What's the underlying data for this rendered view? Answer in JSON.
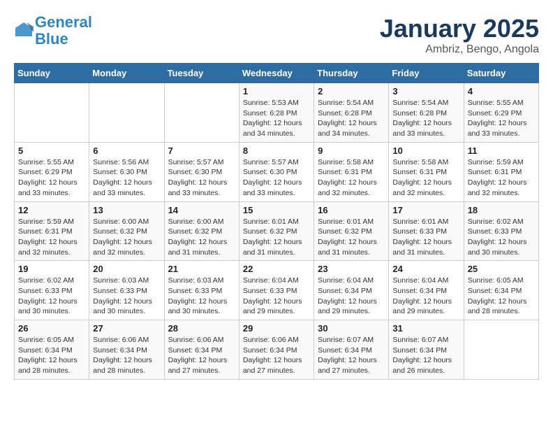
{
  "logo": {
    "line1": "General",
    "line2": "Blue"
  },
  "title": "January 2025",
  "subtitle": "Ambriz, Bengo, Angola",
  "weekdays": [
    "Sunday",
    "Monday",
    "Tuesday",
    "Wednesday",
    "Thursday",
    "Friday",
    "Saturday"
  ],
  "weeks": [
    [
      {
        "day": "",
        "info": ""
      },
      {
        "day": "",
        "info": ""
      },
      {
        "day": "",
        "info": ""
      },
      {
        "day": "1",
        "info": "Sunrise: 5:53 AM\nSunset: 6:28 PM\nDaylight: 12 hours\nand 34 minutes."
      },
      {
        "day": "2",
        "info": "Sunrise: 5:54 AM\nSunset: 6:28 PM\nDaylight: 12 hours\nand 34 minutes."
      },
      {
        "day": "3",
        "info": "Sunrise: 5:54 AM\nSunset: 6:28 PM\nDaylight: 12 hours\nand 33 minutes."
      },
      {
        "day": "4",
        "info": "Sunrise: 5:55 AM\nSunset: 6:29 PM\nDaylight: 12 hours\nand 33 minutes."
      }
    ],
    [
      {
        "day": "5",
        "info": "Sunrise: 5:55 AM\nSunset: 6:29 PM\nDaylight: 12 hours\nand 33 minutes."
      },
      {
        "day": "6",
        "info": "Sunrise: 5:56 AM\nSunset: 6:30 PM\nDaylight: 12 hours\nand 33 minutes."
      },
      {
        "day": "7",
        "info": "Sunrise: 5:57 AM\nSunset: 6:30 PM\nDaylight: 12 hours\nand 33 minutes."
      },
      {
        "day": "8",
        "info": "Sunrise: 5:57 AM\nSunset: 6:30 PM\nDaylight: 12 hours\nand 33 minutes."
      },
      {
        "day": "9",
        "info": "Sunrise: 5:58 AM\nSunset: 6:31 PM\nDaylight: 12 hours\nand 32 minutes."
      },
      {
        "day": "10",
        "info": "Sunrise: 5:58 AM\nSunset: 6:31 PM\nDaylight: 12 hours\nand 32 minutes."
      },
      {
        "day": "11",
        "info": "Sunrise: 5:59 AM\nSunset: 6:31 PM\nDaylight: 12 hours\nand 32 minutes."
      }
    ],
    [
      {
        "day": "12",
        "info": "Sunrise: 5:59 AM\nSunset: 6:31 PM\nDaylight: 12 hours\nand 32 minutes."
      },
      {
        "day": "13",
        "info": "Sunrise: 6:00 AM\nSunset: 6:32 PM\nDaylight: 12 hours\nand 32 minutes."
      },
      {
        "day": "14",
        "info": "Sunrise: 6:00 AM\nSunset: 6:32 PM\nDaylight: 12 hours\nand 31 minutes."
      },
      {
        "day": "15",
        "info": "Sunrise: 6:01 AM\nSunset: 6:32 PM\nDaylight: 12 hours\nand 31 minutes."
      },
      {
        "day": "16",
        "info": "Sunrise: 6:01 AM\nSunset: 6:32 PM\nDaylight: 12 hours\nand 31 minutes."
      },
      {
        "day": "17",
        "info": "Sunrise: 6:01 AM\nSunset: 6:33 PM\nDaylight: 12 hours\nand 31 minutes."
      },
      {
        "day": "18",
        "info": "Sunrise: 6:02 AM\nSunset: 6:33 PM\nDaylight: 12 hours\nand 30 minutes."
      }
    ],
    [
      {
        "day": "19",
        "info": "Sunrise: 6:02 AM\nSunset: 6:33 PM\nDaylight: 12 hours\nand 30 minutes."
      },
      {
        "day": "20",
        "info": "Sunrise: 6:03 AM\nSunset: 6:33 PM\nDaylight: 12 hours\nand 30 minutes."
      },
      {
        "day": "21",
        "info": "Sunrise: 6:03 AM\nSunset: 6:33 PM\nDaylight: 12 hours\nand 30 minutes."
      },
      {
        "day": "22",
        "info": "Sunrise: 6:04 AM\nSunset: 6:33 PM\nDaylight: 12 hours\nand 29 minutes."
      },
      {
        "day": "23",
        "info": "Sunrise: 6:04 AM\nSunset: 6:34 PM\nDaylight: 12 hours\nand 29 minutes."
      },
      {
        "day": "24",
        "info": "Sunrise: 6:04 AM\nSunset: 6:34 PM\nDaylight: 12 hours\nand 29 minutes."
      },
      {
        "day": "25",
        "info": "Sunrise: 6:05 AM\nSunset: 6:34 PM\nDaylight: 12 hours\nand 28 minutes."
      }
    ],
    [
      {
        "day": "26",
        "info": "Sunrise: 6:05 AM\nSunset: 6:34 PM\nDaylight: 12 hours\nand 28 minutes."
      },
      {
        "day": "27",
        "info": "Sunrise: 6:06 AM\nSunset: 6:34 PM\nDaylight: 12 hours\nand 28 minutes."
      },
      {
        "day": "28",
        "info": "Sunrise: 6:06 AM\nSunset: 6:34 PM\nDaylight: 12 hours\nand 27 minutes."
      },
      {
        "day": "29",
        "info": "Sunrise: 6:06 AM\nSunset: 6:34 PM\nDaylight: 12 hours\nand 27 minutes."
      },
      {
        "day": "30",
        "info": "Sunrise: 6:07 AM\nSunset: 6:34 PM\nDaylight: 12 hours\nand 27 minutes."
      },
      {
        "day": "31",
        "info": "Sunrise: 6:07 AM\nSunset: 6:34 PM\nDaylight: 12 hours\nand 26 minutes."
      },
      {
        "day": "",
        "info": ""
      }
    ]
  ]
}
